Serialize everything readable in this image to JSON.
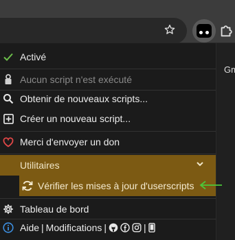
{
  "menu": {
    "enabled": "Activé",
    "no_script": "Aucun script n'est exécuté",
    "get_scripts": "Obtenir de nouveaux scripts...",
    "create_script": "Créer un nouveau script...",
    "donate": "Merci d'envoyer un don",
    "utilities": "Utilitaires",
    "check_updates": "Vérifier les mises à jour d'userscripts",
    "dashboard": "Tableau de bord",
    "help": "Aide",
    "pipe1": "|",
    "changes": "Modifications",
    "pipe2": "|",
    "pipe3": "|"
  },
  "page": {
    "snippet": "Gm"
  },
  "colors": {
    "highlight": "#7c5a13",
    "check": "#6cbf4a",
    "heart": "#e34848",
    "info": "#3d8fe0",
    "annotation_arrow": "#4cc83a"
  },
  "icons": {
    "star": "star-icon",
    "extension": "tampermonkey-icon",
    "puzzle": "puzzle-icon",
    "check": "check-icon",
    "lock": "lock-icon",
    "search": "search-icon",
    "plus": "plus-box-icon",
    "heart": "heart-icon",
    "chevron": "chevron-down-icon",
    "refresh": "refresh-icon",
    "gear": "gear-icon",
    "info": "info-icon"
  }
}
